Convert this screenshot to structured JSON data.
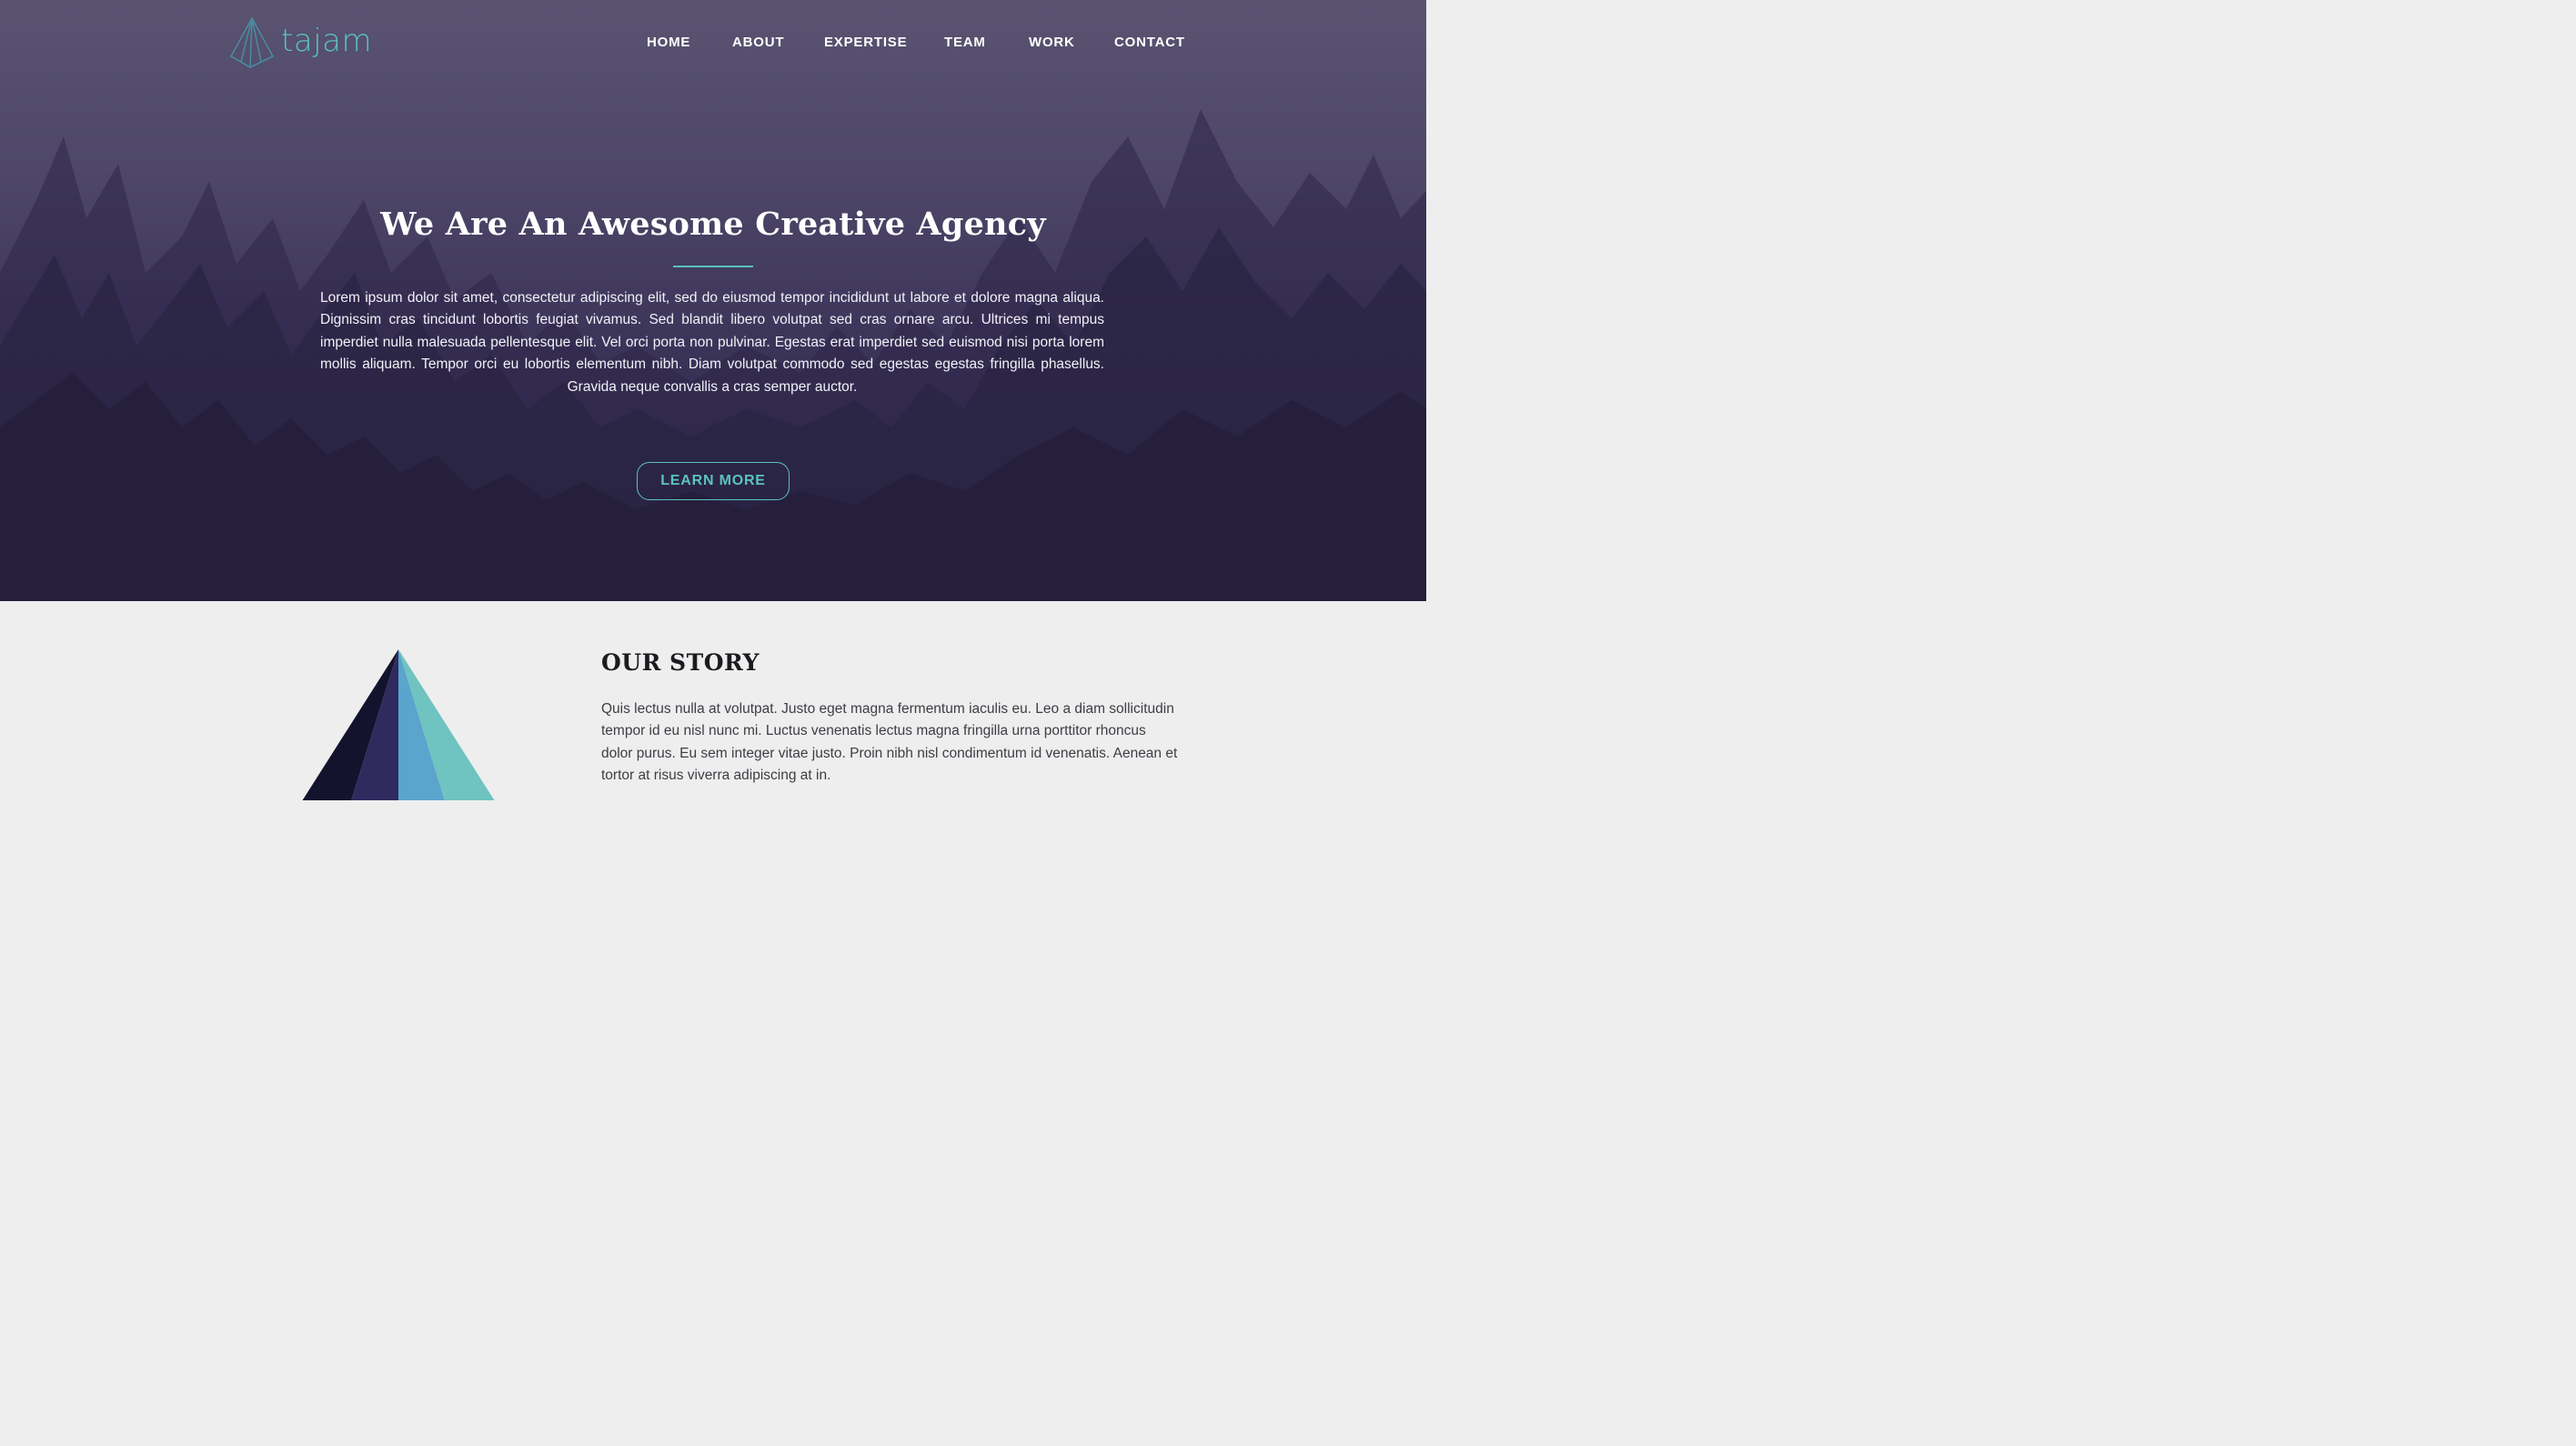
{
  "brand": {
    "name": "tajam",
    "accent": "#5ac3bd"
  },
  "nav": {
    "items": [
      {
        "label": "HOME"
      },
      {
        "label": "ABOUT"
      },
      {
        "label": "EXPERTISE"
      },
      {
        "label": "TEAM"
      },
      {
        "label": "WORK"
      },
      {
        "label": "CONTACT"
      }
    ]
  },
  "hero": {
    "title": "We Are An Awesome Creative Agency",
    "text": "Lorem ipsum dolor sit amet, consectetur adipiscing elit, sed do eiusmod tempor incididunt ut labore et dolore magna aliqua. Dignissim cras tincidunt lobortis feugiat vivamus. Sed blandit libero volutpat sed cras ornare arcu. Ultrices mi tempus imperdiet nulla malesuada pellentesque elit. Vel orci porta non pulvinar. Egestas erat imperdiet sed euismod nisi porta lorem mollis aliquam. Tempor orci eu lobortis elementum nibh. Diam volutpat commodo sed egestas egestas fringilla phasellus. Gravida neque convallis a cras semper auctor.",
    "button_label": "LEARN MORE"
  },
  "story": {
    "title": "OUR STORY",
    "text": "Quis lectus nulla at volutpat. Justo eget magna fermentum iaculis eu. Leo a diam sollicitudin tempor id eu nisl nunc mi. Luctus venenatis lectus magna fringilla urna porttitor rhoncus dolor purus. Eu sem integer vitae justo. Proin nibh nisl condimentum id venenatis. Aenean et tortor at risus viverra adipiscing at in."
  },
  "colors": {
    "hero_top": "#5a5370",
    "hero_bottom": "#28213f",
    "pyramid_dark": "#14132e",
    "pyramid_purple": "#312a5e",
    "pyramid_blue": "#5aa4cd",
    "pyramid_teal": "#6fc3c1"
  }
}
